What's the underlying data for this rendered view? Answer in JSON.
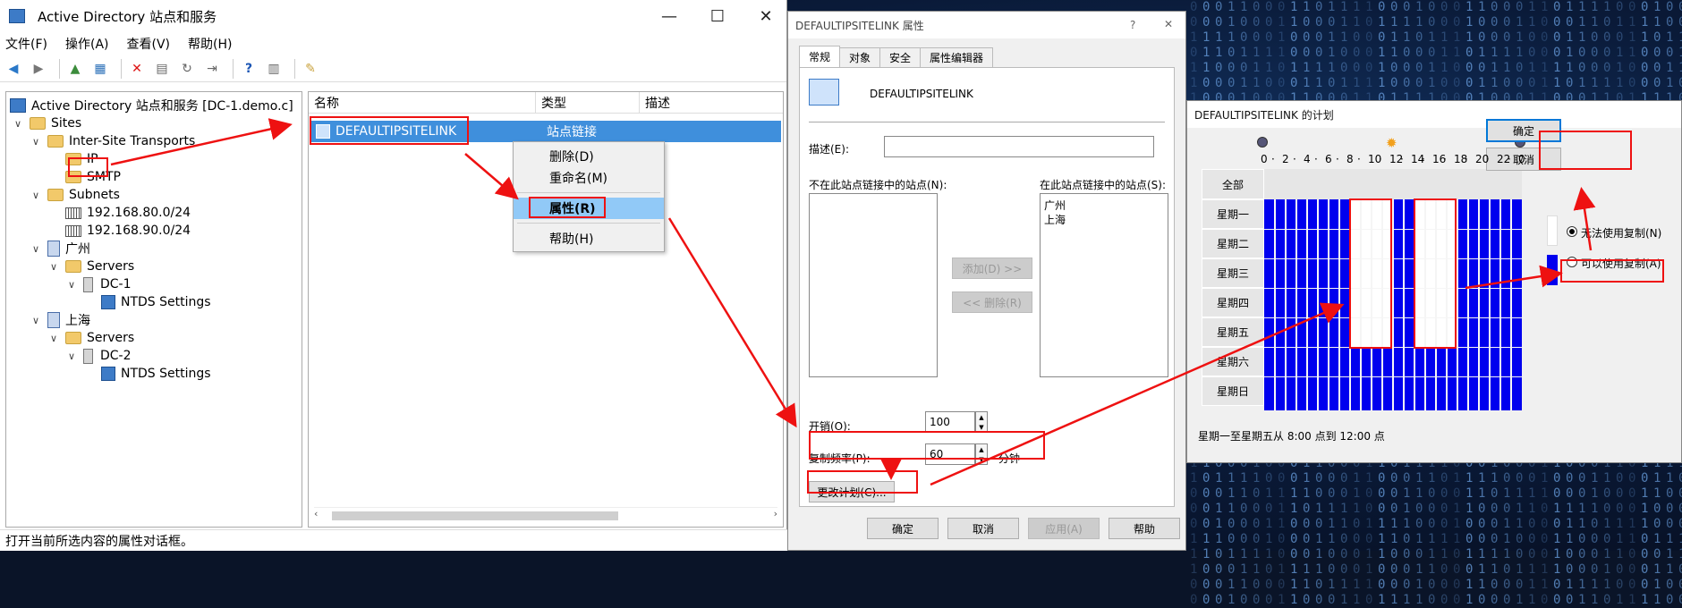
{
  "main_window": {
    "title": "Active Directory 站点和服务",
    "controls": {
      "minimize": "—",
      "maximize": "☐",
      "close": "✕"
    },
    "menu": [
      "文件(F)",
      "操作(A)",
      "查看(V)",
      "帮助(H)"
    ],
    "tree": {
      "root": "Active Directory 站点和服务 [DC-1.demo.c]",
      "sites": "Sites",
      "inter_site_transports": "Inter-Site Transports",
      "ip": "IP",
      "smtp": "SMTP",
      "subnets": "Subnets",
      "subnet1": "192.168.80.0/24",
      "subnet2": "192.168.90.0/24",
      "site_gz": "广州",
      "servers_gz": "Servers",
      "dc1": "DC-1",
      "ntds1": "NTDS Settings",
      "site_sh": "上海",
      "servers_sh": "Servers",
      "dc2": "DC-2",
      "ntds2": "NTDS Settings"
    },
    "list": {
      "headers": [
        "名称",
        "类型",
        "描述"
      ],
      "row": {
        "name": "DEFAULTIPSITELINK",
        "type": "站点链接"
      }
    },
    "context_menu": [
      "删除(D)",
      "重命名(M)",
      "属性(R)",
      "帮助(H)"
    ],
    "status": "打开当前所选内容的属性对话框。"
  },
  "properties_dialog": {
    "title": "DEFAULTIPSITELINK 属性",
    "help": "?",
    "close": "✕",
    "tabs": [
      "常规",
      "对象",
      "安全",
      "属性编辑器"
    ],
    "link_name": "DEFAULTIPSITELINK",
    "description_label": "描述(E):",
    "not_in_label": "不在此站点链接中的站点(N):",
    "in_label": "在此站点链接中的站点(S):",
    "in_sites": [
      "广州",
      "上海"
    ],
    "add_button": "添加(D) >>",
    "remove_button": "<< 删除(R)",
    "cost_label": "开销(O):",
    "cost_value": "100",
    "freq_label": "复制频率(P):",
    "freq_value": "60",
    "freq_unit": "分钟",
    "change_schedule_button": "更改计划(C)...",
    "ok": "确定",
    "cancel": "取消",
    "apply": "应用(A)",
    "help_button": "帮助"
  },
  "schedule_dialog": {
    "title": "DEFAULTIPSITELINK 的计划",
    "hours": [
      "0",
      "2",
      "4",
      "6",
      "8",
      "10",
      "12",
      "14",
      "16",
      "18",
      "20",
      "22",
      "0"
    ],
    "all_label": "全部",
    "days": [
      "星期一",
      "星期二",
      "星期三",
      "星期四",
      "星期五",
      "星期六",
      "星期日"
    ],
    "ok": "确定",
    "cancel": "取消",
    "option_unavailable": "无法使用复制(N)",
    "option_available": "可以使用复制(A)",
    "summary": "星期一至星期五从 8:00 点到 12:00 点",
    "colors": {
      "available": "#0000ee",
      "unavailable": "#ffffff",
      "annotation": "#e11111"
    }
  }
}
